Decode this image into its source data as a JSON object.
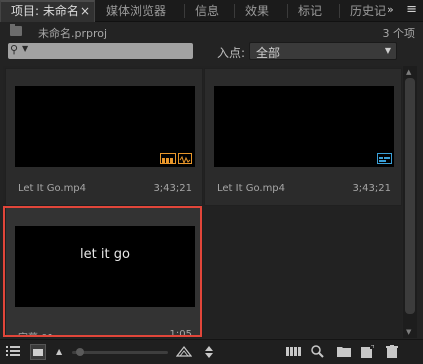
{
  "tabs": [
    {
      "label": "项目: 未命名",
      "active": true,
      "close": "×"
    },
    {
      "label": "媒体浏览器"
    },
    {
      "label": "信息"
    },
    {
      "label": "效果"
    },
    {
      "label": "标记"
    },
    {
      "label": "历史记"
    }
  ],
  "tab_overflow": "»",
  "panel_menu": "≡",
  "project": {
    "name": "未命名.prproj",
    "item_count": "3 个项"
  },
  "search": {
    "value": "",
    "icon": "magnifier-icon"
  },
  "in_point": {
    "label": "入点:",
    "value": "全部"
  },
  "items": [
    {
      "name": "Let It Go.mp4",
      "duration": "3;43;21",
      "badge": "audio-video-icon"
    },
    {
      "name": "Let It Go.mp4",
      "duration": "3;43;21",
      "badge": "sequence-icon"
    },
    {
      "name": "字幕 01",
      "duration": "1;05",
      "title_text": "let it go",
      "selected": true
    }
  ],
  "colors": {
    "selection": "#e1463a",
    "badge_orange": "#e8962a",
    "badge_blue": "#3aa0d8"
  },
  "toolbar": {
    "zoom": "small-thumbnail-zoom"
  }
}
